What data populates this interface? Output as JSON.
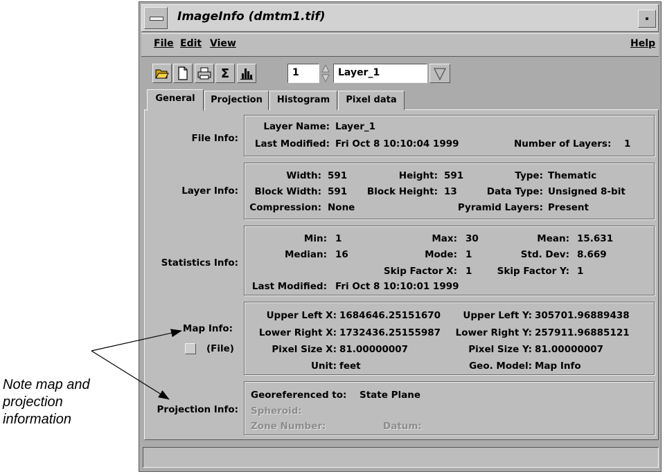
{
  "annotation": {
    "text_lines": [
      "Note map and",
      "projection",
      "information"
    ]
  },
  "window": {
    "title": "ImageInfo (dmtm1.tif)"
  },
  "menubar": {
    "file": "File",
    "edit": "Edit",
    "view": "View",
    "help": "Help"
  },
  "toolbar": {
    "layer_number": "1",
    "layer_select": "Layer_1",
    "sigma_glyph": "Σ"
  },
  "tabs": [
    "General",
    "Projection",
    "Histogram",
    "Pixel data"
  ],
  "file_info": {
    "section_label": "File Info:",
    "layer_name_label": "Layer Name:",
    "layer_name": "Layer_1",
    "last_modified_label": "Last Modified:",
    "last_modified": "Fri Oct  8 10:10:04 1999",
    "num_layers_label": "Number of Layers:",
    "num_layers": "1"
  },
  "layer_info": {
    "section_label": "Layer Info:",
    "width_label": "Width:",
    "width": "591",
    "height_label": "Height:",
    "height": "591",
    "type_label": "Type:",
    "type": "Thematic",
    "block_width_label": "Block Width:",
    "block_width": "591",
    "block_height_label": "Block Height:",
    "block_height": "13",
    "data_type_label": "Data Type:",
    "data_type": "Unsigned 8-bit",
    "compression_label": "Compression:",
    "compression": "None",
    "pyramid_label": "Pyramid Layers:",
    "pyramid": "Present"
  },
  "statistics_info": {
    "section_label": "Statistics Info:",
    "min_label": "Min:",
    "min": "1",
    "max_label": "Max:",
    "max": "30",
    "mean_label": "Mean:",
    "mean": "15.631",
    "median_label": "Median:",
    "median": "16",
    "mode_label": "Mode:",
    "mode": "1",
    "std_label": "Std. Dev:",
    "std": "8.669",
    "skip_x_label": "Skip Factor X:",
    "skip_x": "1",
    "skip_y_label": "Skip Factor Y:",
    "skip_y": "1",
    "last_modified_label": "Last Modified:",
    "last_modified": "Fri Oct  8 10:10:01 1999"
  },
  "map_info": {
    "section_label": "Map Info:",
    "file_toggle_label": "(File)",
    "upper_left_x_label": "Upper Left X:",
    "upper_left_x": "1684646.25151670",
    "upper_left_y_label": "Upper Left Y:",
    "upper_left_y": "305701.96889438",
    "lower_right_x_label": "Lower Right X:",
    "lower_right_x": "1732436.25155987",
    "lower_right_y_label": "Lower Right Y:",
    "lower_right_y": "257911.96885121",
    "pixel_size_x_label": "Pixel Size X:",
    "pixel_size_x": "81.00000007",
    "pixel_size_y_label": "Pixel Size Y:",
    "pixel_size_y": "81.00000007",
    "unit_label": "Unit:",
    "unit": "feet",
    "geo_model_label": "Geo. Model:",
    "geo_model": "Map Info"
  },
  "projection_info": {
    "section_label": "Projection Info:",
    "georef_label": "Georeferenced to:",
    "georef": "State Plane",
    "spheroid_label": "Spheroid:",
    "zone_label": "Zone Number:",
    "datum_label": "Datum:"
  },
  "status_bar": {
    "text": ""
  }
}
